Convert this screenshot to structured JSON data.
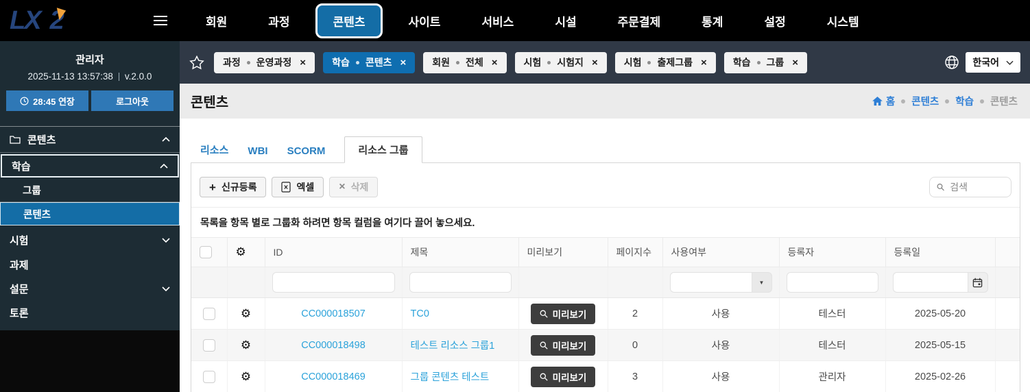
{
  "colors": {
    "accent_blue": "#146da6",
    "chip_active_blue": "#0f6eb0",
    "link_blue": "#2ba2da",
    "breadcrumb_blue": "#2e7fd6",
    "topbar_bg": "#303946",
    "sidebar_bg": "#1d2c34",
    "preview_button_bg": "#3d3d3d",
    "logo_navy": "#26457d",
    "logo_orange": "#f2a33c"
  },
  "topnav": {
    "logo_lx": "LX",
    "logo_num": "2",
    "items": [
      "회원",
      "과정",
      "콘텐츠",
      "사이트",
      "서비스",
      "시설",
      "주문결제",
      "통계",
      "설정",
      "시스템"
    ],
    "active_item": "콘텐츠"
  },
  "sidebar": {
    "user_name": "관리자",
    "datetime": "2025-11-13 13:57:38",
    "version": "v.2.0.0",
    "extend_label": "28:45 연장",
    "logout_label": "로그아웃",
    "section_label": "콘텐츠",
    "menu": {
      "learning": "학습",
      "group": "그룹",
      "contents": "콘텐츠",
      "exam": "시험",
      "assignment": "과제",
      "survey": "설문",
      "discussion": "토론"
    },
    "selected_item": "콘텐츠"
  },
  "tagbar": {
    "chips": [
      {
        "category": "과정",
        "value": "운영과정",
        "active": false
      },
      {
        "category": "학습",
        "value": "콘텐츠",
        "active": true
      },
      {
        "category": "회원",
        "value": "전체",
        "active": false
      },
      {
        "category": "시험",
        "value": "시험지",
        "active": false
      },
      {
        "category": "시험",
        "value": "출제그룹",
        "active": false
      },
      {
        "category": "학습",
        "value": "그룹",
        "active": false
      }
    ],
    "close_glyph": "×",
    "language": "한국어"
  },
  "header": {
    "title": "콘텐츠",
    "breadcrumb": {
      "home": "홈",
      "items": [
        "콘텐츠",
        "학습",
        "콘텐츠"
      ]
    }
  },
  "tabs": {
    "resource": "리소스",
    "wbi": "WBI",
    "scorm": "SCORM",
    "resource_group": "리소스 그룹",
    "active": "리소스 그룹"
  },
  "toolbar": {
    "new_label": "신규등록",
    "excel_label": "엑셀",
    "delete_label": "삭제",
    "delete_glyph": "×",
    "plus_glyph": "+",
    "search_placeholder": "검색"
  },
  "grid": {
    "group_hint": "목록을 항목 별로 그룹화 하려면 항목 컬럼을 여기다 끌어 놓으세요.",
    "columns": {
      "id": "ID",
      "title": "제목",
      "preview": "미리보기",
      "pages": "페이지수",
      "use": "사용여부",
      "registrant": "등록자",
      "reg_date": "등록일"
    },
    "preview_button_label": "미리보기",
    "rows": [
      {
        "id": "CC000018507",
        "title": "TC0",
        "pages": "2",
        "use": "사용",
        "registrant": "테스터",
        "date": "2025-05-20"
      },
      {
        "id": "CC000018498",
        "title": "테스트 리소스 그룹1",
        "pages": "0",
        "use": "사용",
        "registrant": "테스터",
        "date": "2025-05-15"
      },
      {
        "id": "CC000018469",
        "title": "그룹 콘텐츠 테스트",
        "pages": "3",
        "use": "사용",
        "registrant": "관리자",
        "date": "2025-02-26"
      }
    ]
  }
}
